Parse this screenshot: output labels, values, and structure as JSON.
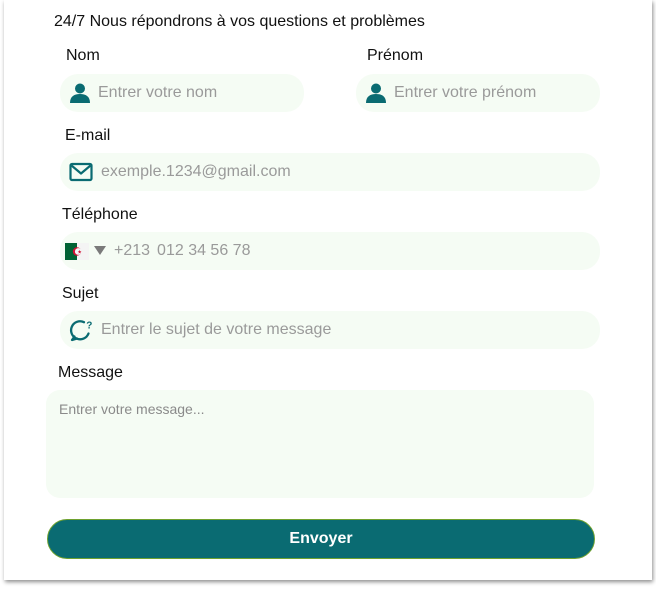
{
  "form": {
    "heading": "24/7 Nous répondrons à vos questions et problèmes",
    "nom": {
      "label": "Nom",
      "placeholder": "Entrer votre nom"
    },
    "prenom": {
      "label": "Prénom",
      "placeholder": "Entrer votre prénom"
    },
    "email": {
      "label": "E-mail",
      "placeholder": "exemple.1234@gmail.com"
    },
    "telephone": {
      "label": "Téléphone",
      "country_code": "+213",
      "placeholder": "012 34 56 78",
      "country": "Algeria"
    },
    "sujet": {
      "label": "Sujet",
      "placeholder": "Entrer le sujet de votre message"
    },
    "message": {
      "label": "Message",
      "placeholder": "Entrer votre message..."
    },
    "submit_label": "Envoyer"
  },
  "colors": {
    "accent": "#0a6b72",
    "field_bg": "#f5fcf4",
    "button_border": "#6ea12f"
  },
  "icons": {
    "nom": "user-icon",
    "prenom": "user-icon",
    "email": "mail-icon",
    "telephone": "algeria-flag-icon",
    "sujet": "chat-question-icon"
  }
}
